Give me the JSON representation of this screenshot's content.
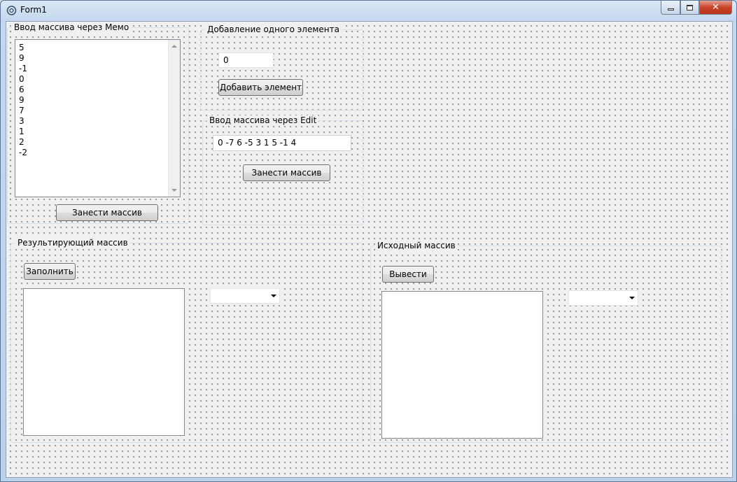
{
  "window": {
    "title": "Form1",
    "minimize": "minimize",
    "maximize": "maximize",
    "close": "close"
  },
  "memo_group": {
    "label": "Ввод массива через Мемо",
    "lines": [
      "5",
      "9",
      "-1",
      "0",
      "6",
      "9",
      "7",
      "3",
      "1",
      "2",
      "-2"
    ],
    "button": "Занести массив"
  },
  "add_group": {
    "label": "Добавление одного элемента",
    "value": "0",
    "button": "Добавить элемент"
  },
  "edit_group": {
    "label": "Ввод массива через Edit",
    "value": "0 -7 6 -5 3 1 5 -1 4",
    "button": "Занести массив"
  },
  "result_group": {
    "label": "Результирующий массив",
    "button": "Заполнить",
    "combo_value": ""
  },
  "source_group": {
    "label": "Исходный массив",
    "button": "Вывести",
    "combo_value": ""
  }
}
